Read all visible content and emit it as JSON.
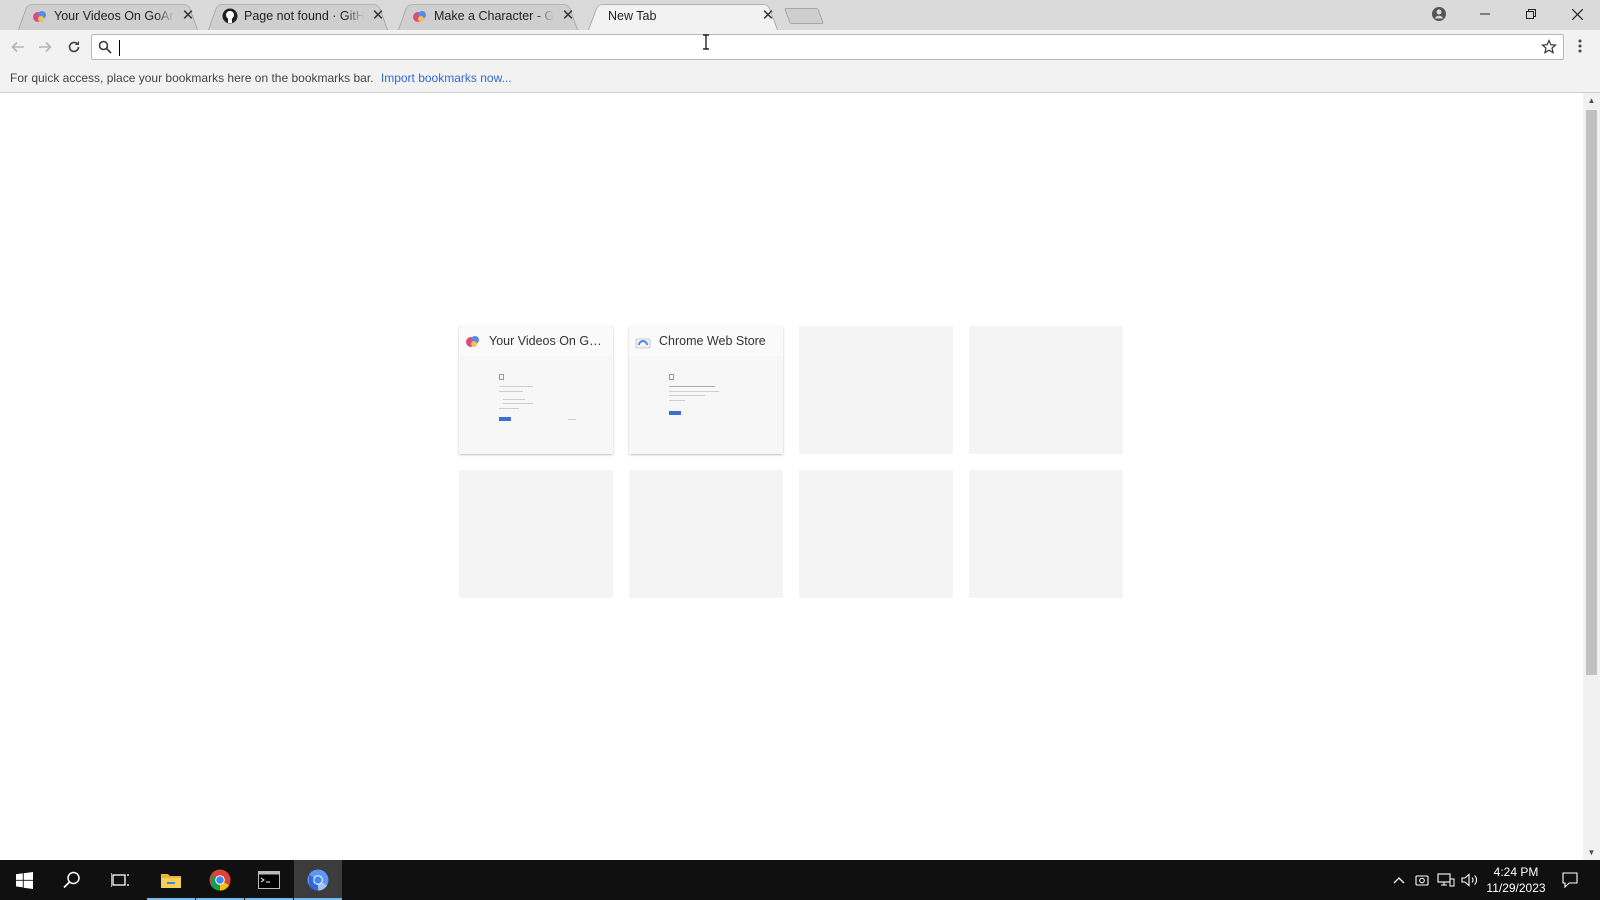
{
  "browser": {
    "tabs": [
      {
        "title": "Your Videos On GoAnimate",
        "favicon": "goanimate-icon",
        "active": false
      },
      {
        "title": "Page not found · GitHub",
        "favicon": "github-icon",
        "active": false
      },
      {
        "title": "Make a Character - GoAnimate",
        "favicon": "goanimate-icon",
        "active": false
      },
      {
        "title": "New Tab",
        "favicon": "",
        "active": true
      }
    ],
    "close_glyph": "✕",
    "omnibox": {
      "value": "",
      "placeholder": ""
    },
    "bookmarks_bar": {
      "message": "For quick access, place your bookmarks here on the bookmarks bar.",
      "import_link": "Import bookmarks now..."
    }
  },
  "new_tab_page": {
    "tiles": [
      {
        "title": "Your Videos On Go...",
        "icon": "goanimate-icon",
        "filled": true
      },
      {
        "title": "Chrome Web Store",
        "icon": "chrome-web-store-icon",
        "filled": true
      },
      {
        "title": "",
        "filled": false
      },
      {
        "title": "",
        "filled": false
      },
      {
        "title": "",
        "filled": false
      },
      {
        "title": "",
        "filled": false
      },
      {
        "title": "",
        "filled": false
      },
      {
        "title": "",
        "filled": false
      }
    ]
  },
  "taskbar": {
    "items": [
      "windows-start-icon",
      "search-icon",
      "task-view-icon",
      "file-explorer-icon",
      "chrome-icon",
      "terminal-icon",
      "chromium-icon"
    ],
    "clock": {
      "time": "4:24 PM",
      "date": "11/29/2023"
    }
  },
  "colors": {
    "accent": "#3367d6",
    "taskbar": "#101010",
    "tabstrip": "#dadada"
  }
}
